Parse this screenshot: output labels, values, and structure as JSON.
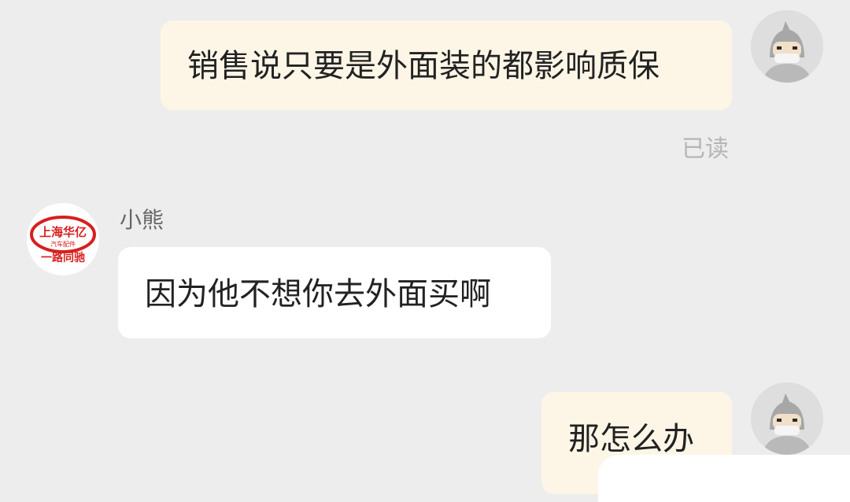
{
  "colors": {
    "background": "#ededed",
    "my_bubble": "#fdf6e7",
    "their_bubble": "#ffffff",
    "read_status": "#b5b5b5",
    "logo_red": "#d6201f"
  },
  "messages": [
    {
      "side": "mine",
      "text": "销售说只要是外面装的都影响质保",
      "status": "已读"
    },
    {
      "side": "theirs",
      "sender": "小熊",
      "text": "因为他不想你去外面买啊"
    },
    {
      "side": "mine",
      "text": "那怎么办"
    }
  ],
  "shop_avatar": {
    "icon": "shop-logo-icon",
    "line1": "上海华亿",
    "line2": "汽车配件",
    "line3": "一路同驰"
  },
  "self_avatar": {
    "icon": "ninja-avatar-icon"
  }
}
